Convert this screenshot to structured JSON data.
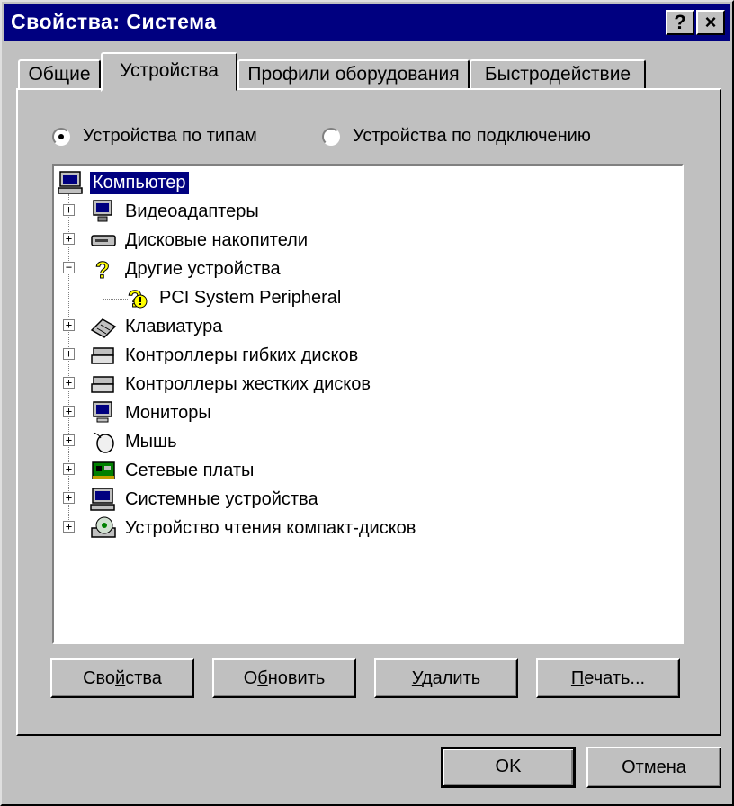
{
  "window": {
    "title": "Свойства: Система",
    "help_label": "?",
    "close_label": "×"
  },
  "tabs": [
    {
      "label": "Общие",
      "active": false
    },
    {
      "label": "Устройства",
      "active": true
    },
    {
      "label": "Профили оборудования",
      "active": false
    },
    {
      "label": "Быстродействие",
      "active": false
    }
  ],
  "view_options": {
    "by_type": {
      "label": "Устройства по типам",
      "checked": true
    },
    "by_connection": {
      "label": "Устройства по подключению",
      "checked": false
    }
  },
  "device_tree": {
    "root": {
      "label": "Компьютер",
      "icon": "computer-icon",
      "selected": true
    },
    "items": [
      {
        "label": "Видеоадаптеры",
        "icon": "display-adapter-icon",
        "expander": "+"
      },
      {
        "label": "Дисковые накопители",
        "icon": "disk-drive-icon",
        "expander": "+"
      },
      {
        "label": "Другие устройства",
        "icon": "question-mark-icon",
        "expander": "−"
      },
      {
        "label": "PCI System Peripheral",
        "icon": "warning-question-icon",
        "child": true
      },
      {
        "label": "Клавиатура",
        "icon": "keyboard-icon",
        "expander": "+"
      },
      {
        "label": "Контроллеры гибких дисков",
        "icon": "floppy-controller-icon",
        "expander": "+"
      },
      {
        "label": "Контроллеры жестких дисков",
        "icon": "hard-disk-controller-icon",
        "expander": "+"
      },
      {
        "label": "Мониторы",
        "icon": "monitor-icon",
        "expander": "+"
      },
      {
        "label": "Мышь",
        "icon": "mouse-icon",
        "expander": "+"
      },
      {
        "label": "Сетевые платы",
        "icon": "network-card-icon",
        "expander": "+"
      },
      {
        "label": "Системные устройства",
        "icon": "system-device-icon",
        "expander": "+"
      },
      {
        "label": "Устройство чтения компакт-дисков",
        "icon": "cdrom-icon",
        "expander": "+"
      }
    ]
  },
  "action_buttons": {
    "properties": {
      "pre": "Сво",
      "u": "й",
      "post": "ства"
    },
    "refresh": {
      "pre": "О",
      "u": "б",
      "post": "новить"
    },
    "remove": {
      "pre": "",
      "u": "У",
      "post": "далить"
    },
    "print": {
      "pre": "",
      "u": "П",
      "post": "ечать..."
    }
  },
  "dialog_buttons": {
    "ok": "OK",
    "cancel": "Отмена"
  },
  "colors": {
    "titlebar": "#000080",
    "face": "#c0c0c0",
    "selection": "#000080"
  }
}
